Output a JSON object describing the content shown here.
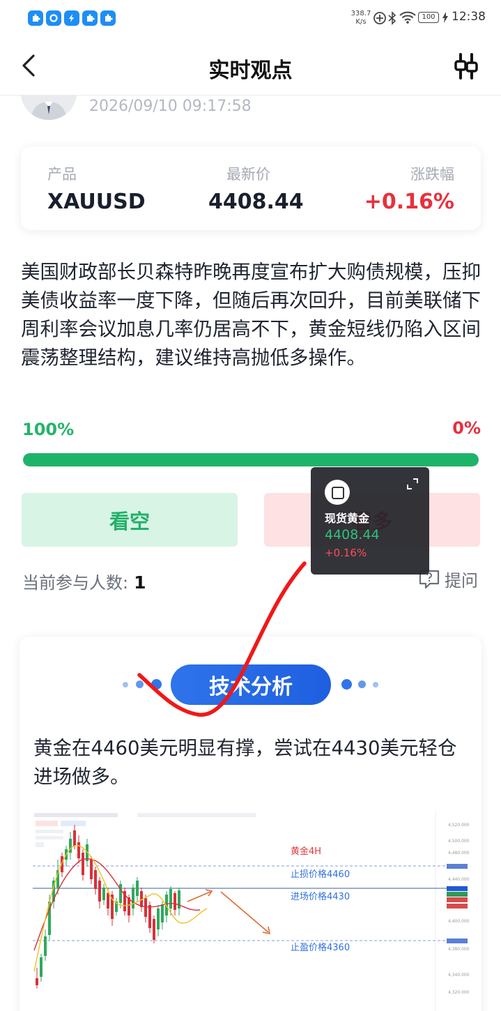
{
  "status_bar": {
    "speed_value": "338.7",
    "speed_unit": "K/s",
    "battery": "100",
    "time": "12:38",
    "app_icons": [
      "puzzle-app-icon",
      "circle-app-icon",
      "bolt-app-icon",
      "puzzle-app-icon",
      "puzzle-app-icon"
    ]
  },
  "header": {
    "title": "实时观点"
  },
  "post": {
    "time": "2026/09/10 09:17:58"
  },
  "product": {
    "label_product": "产品",
    "label_price": "最新价",
    "label_change": "涨跌幅",
    "symbol": "XAUUSD",
    "price": "4408.44",
    "change": "+0.16%"
  },
  "content": {
    "text": "美国财政部长贝森特昨晚再度宣布扩大购债规模，压抑美债收益率一度下降，但随后再次回升，目前美联储下周利率会议加息几率仍居高不下，黄金短线仍陷入区间震荡整理结构，建议维持高抛低多操作。"
  },
  "vote": {
    "left_percent": "100%",
    "right_percent": "0%",
    "left_fraction": 1.0,
    "short_label": "看空",
    "long_label": "看多"
  },
  "participants": {
    "label": "当前参与人数:",
    "count": "1"
  },
  "ask": {
    "label": "提问"
  },
  "ticker_overlay": {
    "name": "现货黄金",
    "price": "4408.44",
    "change": "+0.16%"
  },
  "analysis": {
    "title": "技术分析",
    "text": "黄金在4460美元明显有撑，尝试在4430美元轻仓进场做多。"
  },
  "chart_annotations": {
    "timeframe": "黄金4H",
    "stop_loss": "止损价格4460",
    "entry": "进场价格4430",
    "take_profit": "止盈价格4360"
  },
  "colors": {
    "green": "#1fb36a",
    "red": "#e8303d",
    "blue": "#2f74eb"
  }
}
